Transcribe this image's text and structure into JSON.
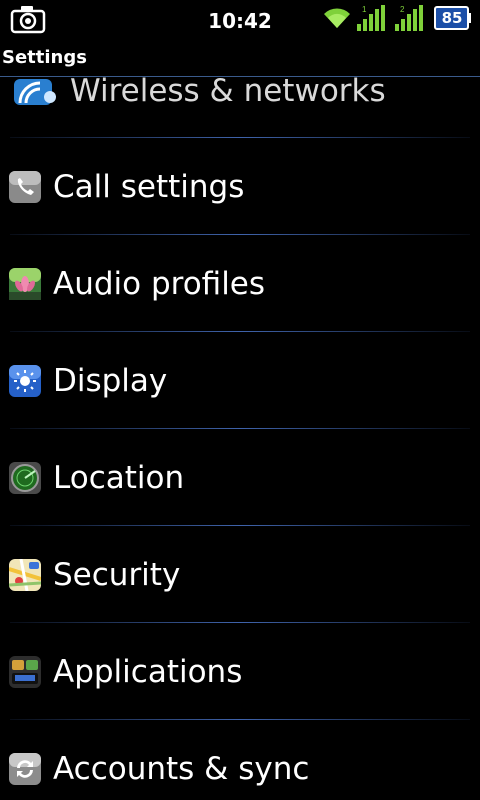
{
  "status_bar": {
    "time": "10:42",
    "battery_level": "85",
    "icons": [
      "camera-icon",
      "wifi-icon",
      "signal-sim1-icon",
      "signal-sim2-icon",
      "battery-icon"
    ]
  },
  "title_bar": {
    "title": "Settings"
  },
  "settings_items": [
    {
      "label": "Wireless & networks",
      "icon": "wireless-icon"
    },
    {
      "label": "Call settings",
      "icon": "phone-icon"
    },
    {
      "label": "Audio profiles",
      "icon": "audio-profiles-icon"
    },
    {
      "label": "Display",
      "icon": "display-brightness-icon"
    },
    {
      "label": "Location",
      "icon": "location-radar-icon"
    },
    {
      "label": "Security",
      "icon": "security-map-icon"
    },
    {
      "label": "Applications",
      "icon": "applications-icon"
    },
    {
      "label": "Accounts & sync",
      "icon": "sync-icon"
    }
  ],
  "colors": {
    "background": "#000000",
    "divider": "#466ebe",
    "text": "#ffffff"
  }
}
